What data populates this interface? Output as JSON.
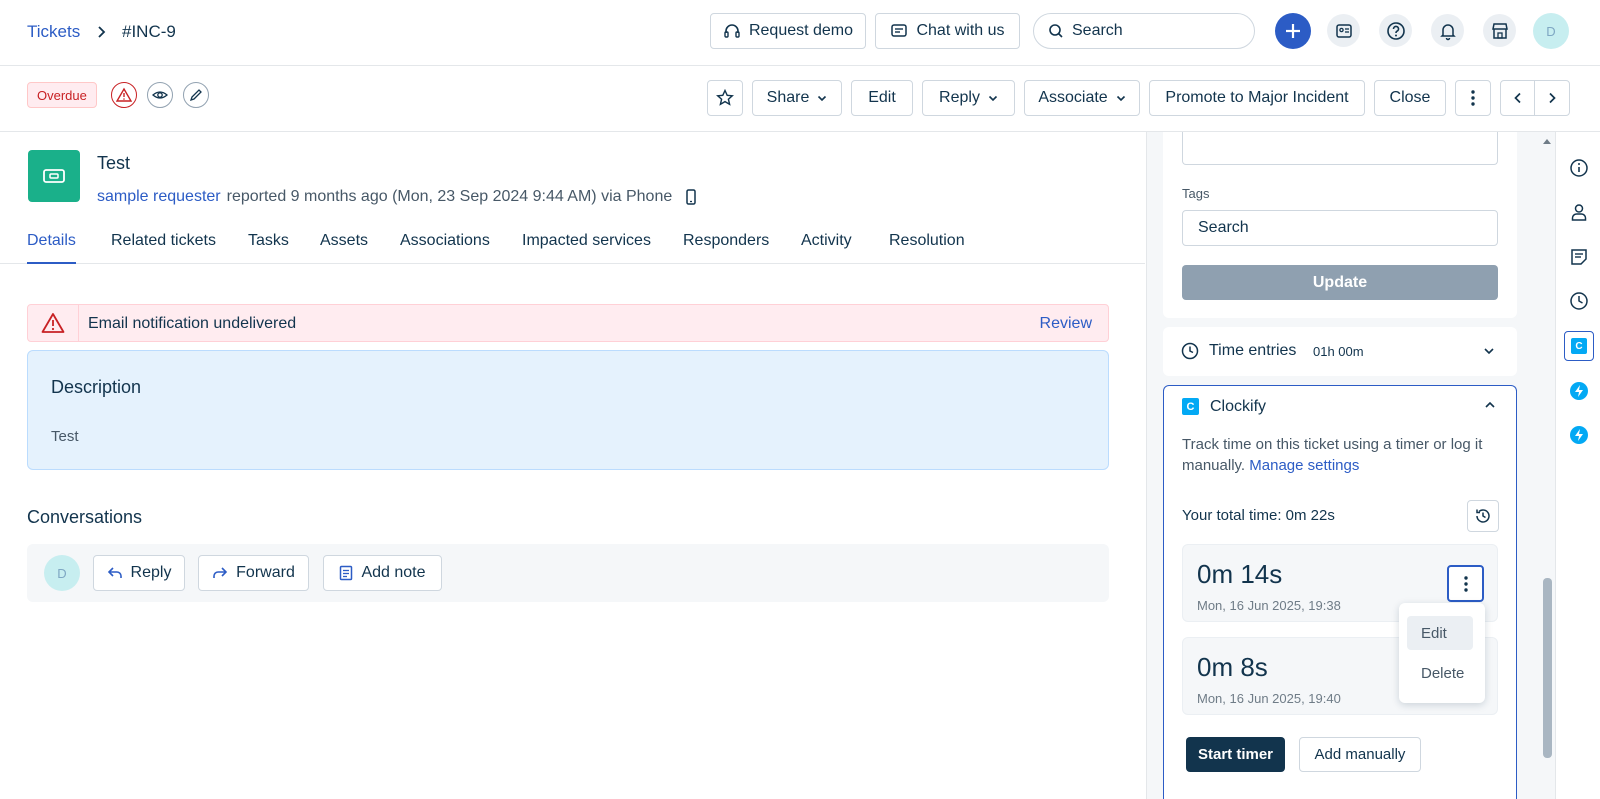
{
  "header": {
    "breadcrumb_link": "Tickets",
    "breadcrumb_current": "#INC-9",
    "request_demo": "Request demo",
    "chat_with_us": "Chat with us",
    "search_placeholder": "Search",
    "avatar_initial": "D",
    "accent_color": "#2c5cc5"
  },
  "toolbar": {
    "status_badge": "Overdue",
    "share": "Share",
    "edit": "Edit",
    "reply": "Reply",
    "associate": "Associate",
    "promote": "Promote to Major Incident",
    "close": "Close"
  },
  "ticket": {
    "title": "Test",
    "requester": "sample requester",
    "meta": "reported 9 months ago (Mon, 23 Sep 2024 9:44 AM) via Phone"
  },
  "tabs": [
    "Details",
    "Related tickets",
    "Tasks",
    "Assets",
    "Associations",
    "Impacted services",
    "Responders",
    "Activity",
    "Resolution"
  ],
  "alert": {
    "text": "Email notification undelivered",
    "action": "Review"
  },
  "description": {
    "heading": "Description",
    "body": "Test"
  },
  "conversations": {
    "heading": "Conversations",
    "avatar_initial": "D",
    "reply": "Reply",
    "forward": "Forward",
    "add_note": "Add note"
  },
  "right_panel": {
    "tags_label": "Tags",
    "tags_placeholder": "Search",
    "update": "Update",
    "time_entries_label": "Time entries",
    "time_entries_total": "01h 00m",
    "clockify": {
      "title": "Clockify",
      "logo_letter": "C",
      "desc": "Track time on this ticket using a timer or log it manually.",
      "manage_link": "Manage settings",
      "total_time": "Your total time: 0m 22s",
      "entries": [
        {
          "duration": "0m 14s",
          "date": "Mon, 16 Jun 2025, 19:38"
        },
        {
          "duration": "0m 8s",
          "date": "Mon, 16 Jun 2025, 19:40"
        }
      ],
      "menu": [
        "Edit",
        "Delete"
      ],
      "start_timer": "Start timer",
      "add_manually": "Add manually"
    }
  },
  "side_strip": {
    "clockify_letter": "C"
  }
}
